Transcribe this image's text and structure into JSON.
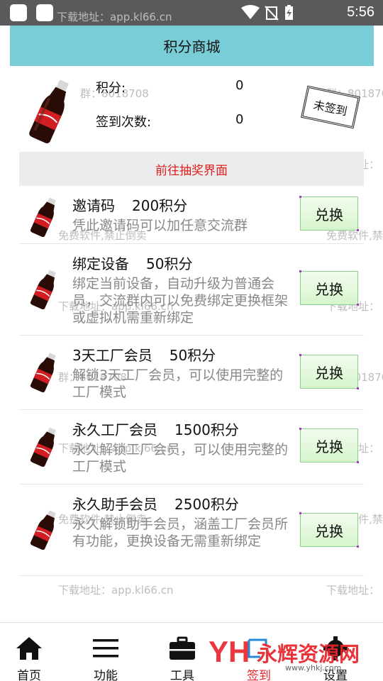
{
  "status_bar": {
    "time": "5:56"
  },
  "header": {
    "title": "积分商城"
  },
  "profile": {
    "points_label": "积分:",
    "points_value": "0",
    "signin_label": "签到次数:",
    "signin_value": "0",
    "stamp": "未签到"
  },
  "lottery_link": "前往抽奖界面",
  "items": [
    {
      "title": "邀请码",
      "points": "200积分",
      "desc": "凭此邀请码可以加任意交流群",
      "button": "兑换"
    },
    {
      "title": "绑定设备",
      "points": "50积分",
      "desc": "绑定当前设备，自动升级为普通会员，交流群内可以免费绑定更换框架或虚拟机需重新绑定",
      "button": "兑换"
    },
    {
      "title": "3天工厂会员",
      "points": "50积分",
      "desc": "解锁3天工厂会员，可以使用完整的工厂模式",
      "button": "兑换"
    },
    {
      "title": "永久工厂会员",
      "points": "1500积分",
      "desc": "永久解锁工厂会员，可以使用完整的工厂模式",
      "button": "兑换"
    },
    {
      "title": "永久助手会员",
      "points": "2500积分",
      "desc": "永久解锁助手会员，涵盖工厂会员所有功能，更换设备无需重新绑定",
      "button": "兑换"
    }
  ],
  "watermarks": {
    "download": "下载地址：app.kl66.cn",
    "download_short": "下载地址：",
    "group": "群：8018708",
    "group_short": "群：801870",
    "free": "免费软件,禁止倒卖",
    "free_short": "免费软件,禁"
  },
  "tabs": [
    {
      "label": "首页",
      "icon": "home-icon"
    },
    {
      "label": "功能",
      "icon": "menu-icon"
    },
    {
      "label": "工具",
      "icon": "toolbox-icon"
    },
    {
      "label": "签到",
      "icon": "signin-icon"
    },
    {
      "label": "设置",
      "icon": "gear-icon"
    }
  ],
  "brand": {
    "name": "永辉资源网",
    "logo": "YH",
    "url": "www.yhkj.com"
  },
  "colors": {
    "header": "#78cdd6",
    "lottery_text": "#e02020",
    "brand_red": "#e8232a"
  }
}
